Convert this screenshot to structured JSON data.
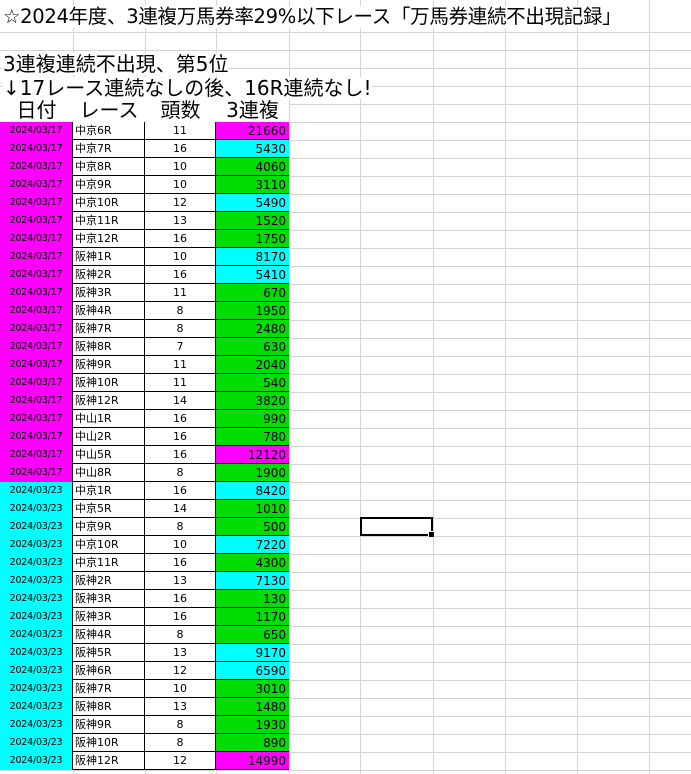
{
  "title": "☆2024年度、3連複万馬券率29%以下レース「万馬券連続不出現記録」",
  "subtitle1": "3連複連続不出現、第5位",
  "subtitle2": "↓17レース連続なしの後、16R連続なし!",
  "headers": {
    "date": "日付",
    "race": "レース",
    "heads": "頭数",
    "payout": "3連複"
  },
  "colors": {
    "magenta": "#ff00ff",
    "cyan": "#00ffff",
    "green": "#00dd00"
  },
  "rows": [
    {
      "date": "2024/03/17",
      "race": "中京6R",
      "heads": "11",
      "payout": "21660",
      "pay_color": "magenta"
    },
    {
      "date": "2024/03/17",
      "race": "中京7R",
      "heads": "16",
      "payout": "5430",
      "pay_color": "cyan"
    },
    {
      "date": "2024/03/17",
      "race": "中京8R",
      "heads": "10",
      "payout": "4060",
      "pay_color": "green"
    },
    {
      "date": "2024/03/17",
      "race": "中京9R",
      "heads": "10",
      "payout": "3110",
      "pay_color": "green"
    },
    {
      "date": "2024/03/17",
      "race": "中京10R",
      "heads": "12",
      "payout": "5490",
      "pay_color": "cyan"
    },
    {
      "date": "2024/03/17",
      "race": "中京11R",
      "heads": "13",
      "payout": "1520",
      "pay_color": "green"
    },
    {
      "date": "2024/03/17",
      "race": "中京12R",
      "heads": "16",
      "payout": "1750",
      "pay_color": "green"
    },
    {
      "date": "2024/03/17",
      "race": "阪神1R",
      "heads": "10",
      "payout": "8170",
      "pay_color": "cyan"
    },
    {
      "date": "2024/03/17",
      "race": "阪神2R",
      "heads": "16",
      "payout": "5410",
      "pay_color": "cyan"
    },
    {
      "date": "2024/03/17",
      "race": "阪神3R",
      "heads": "11",
      "payout": "670",
      "pay_color": "green"
    },
    {
      "date": "2024/03/17",
      "race": "阪神4R",
      "heads": "8",
      "payout": "1950",
      "pay_color": "green"
    },
    {
      "date": "2024/03/17",
      "race": "阪神7R",
      "heads": "8",
      "payout": "2480",
      "pay_color": "green"
    },
    {
      "date": "2024/03/17",
      "race": "阪神8R",
      "heads": "7",
      "payout": "630",
      "pay_color": "green"
    },
    {
      "date": "2024/03/17",
      "race": "阪神9R",
      "heads": "11",
      "payout": "2040",
      "pay_color": "green"
    },
    {
      "date": "2024/03/17",
      "race": "阪神10R",
      "heads": "11",
      "payout": "540",
      "pay_color": "green"
    },
    {
      "date": "2024/03/17",
      "race": "阪神12R",
      "heads": "14",
      "payout": "3820",
      "pay_color": "green"
    },
    {
      "date": "2024/03/17",
      "race": "中山1R",
      "heads": "16",
      "payout": "990",
      "pay_color": "green"
    },
    {
      "date": "2024/03/17",
      "race": "中山2R",
      "heads": "16",
      "payout": "780",
      "pay_color": "green"
    },
    {
      "date": "2024/03/17",
      "race": "中山5R",
      "heads": "16",
      "payout": "12120",
      "pay_color": "magenta"
    },
    {
      "date": "2024/03/17",
      "race": "中山8R",
      "heads": "8",
      "payout": "1900",
      "pay_color": "green"
    },
    {
      "date": "2024/03/23",
      "race": "中京1R",
      "heads": "16",
      "payout": "8420",
      "pay_color": "cyan"
    },
    {
      "date": "2024/03/23",
      "race": "中京5R",
      "heads": "14",
      "payout": "1010",
      "pay_color": "green"
    },
    {
      "date": "2024/03/23",
      "race": "中京9R",
      "heads": "8",
      "payout": "500",
      "pay_color": "green"
    },
    {
      "date": "2024/03/23",
      "race": "中京10R",
      "heads": "10",
      "payout": "7220",
      "pay_color": "cyan"
    },
    {
      "date": "2024/03/23",
      "race": "中京11R",
      "heads": "16",
      "payout": "4300",
      "pay_color": "green"
    },
    {
      "date": "2024/03/23",
      "race": "阪神2R",
      "heads": "13",
      "payout": "7130",
      "pay_color": "cyan"
    },
    {
      "date": "2024/03/23",
      "race": "阪神3R",
      "heads": "16",
      "payout": "130",
      "pay_color": "green"
    },
    {
      "date": "2024/03/23",
      "race": "阪神3R",
      "heads": "16",
      "payout": "1170",
      "pay_color": "green"
    },
    {
      "date": "2024/03/23",
      "race": "阪神4R",
      "heads": "8",
      "payout": "650",
      "pay_color": "green"
    },
    {
      "date": "2024/03/23",
      "race": "阪神5R",
      "heads": "13",
      "payout": "9170",
      "pay_color": "cyan"
    },
    {
      "date": "2024/03/23",
      "race": "阪神6R",
      "heads": "12",
      "payout": "6590",
      "pay_color": "cyan"
    },
    {
      "date": "2024/03/23",
      "race": "阪神7R",
      "heads": "10",
      "payout": "3010",
      "pay_color": "green"
    },
    {
      "date": "2024/03/23",
      "race": "阪神8R",
      "heads": "13",
      "payout": "1480",
      "pay_color": "green"
    },
    {
      "date": "2024/03/23",
      "race": "阪神9R",
      "heads": "8",
      "payout": "1930",
      "pay_color": "green"
    },
    {
      "date": "2024/03/23",
      "race": "阪神10R",
      "heads": "8",
      "payout": "890",
      "pay_color": "green"
    },
    {
      "date": "2024/03/23",
      "race": "阪神12R",
      "heads": "12",
      "payout": "14990",
      "pay_color": "magenta"
    }
  ]
}
